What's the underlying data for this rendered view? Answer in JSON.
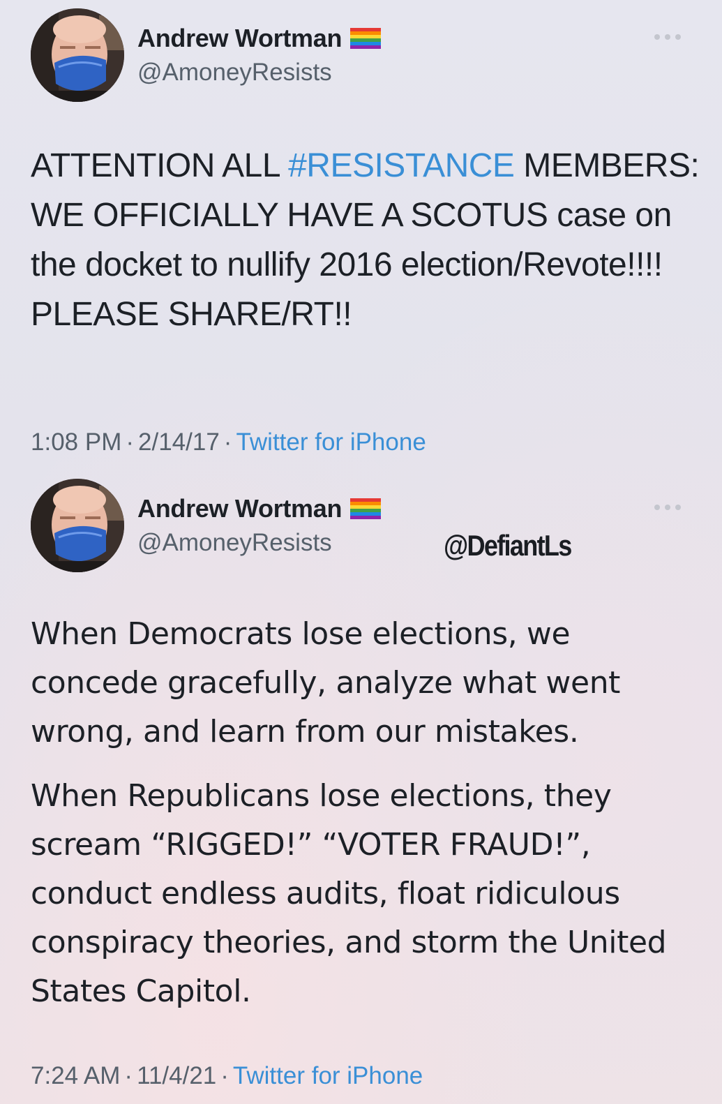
{
  "tweets": [
    {
      "author": {
        "display_name": "Andrew Wortman",
        "handle": "@AmoneyResists",
        "flag_icon": "rainbow-flag-icon"
      },
      "text": {
        "hashtag_prefix": "ATTENTION ALL ",
        "hashtag": "#RESISTANCE",
        "rest": " MEMBERS: WE OFFICIALLY HAVE A SCOTUS case on the docket to nullify 2016 election/Revote!!!! PLEASE SHARE/RT!!"
      },
      "meta": {
        "time": "1:08 PM",
        "separator": "·",
        "date": "2/14/17",
        "source": "Twitter for iPhone"
      }
    },
    {
      "author": {
        "display_name": "Andrew Wortman",
        "handle": "@AmoneyResists",
        "flag_icon": "rainbow-flag-icon"
      },
      "text": {
        "paragraph_1": "When Democrats lose elections, we concede gracefully, analyze what went wrong, and learn from our mistakes.",
        "paragraph_2": "When Republicans lose elections, they scream “RIGGED!” “VOTER FRAUD!”, conduct endless audits, float ridiculous conspiracy theories, and storm the United States Capitol."
      },
      "meta": {
        "time": "7:24 AM",
        "separator": "·",
        "date": "11/4/21",
        "source": "Twitter for iPhone"
      }
    }
  ],
  "watermark": "@DefiantLs",
  "colors": {
    "link": "#3a8fd6",
    "text": "#1c2026",
    "secondary": "#56606b",
    "mask": "#2f63c4"
  }
}
